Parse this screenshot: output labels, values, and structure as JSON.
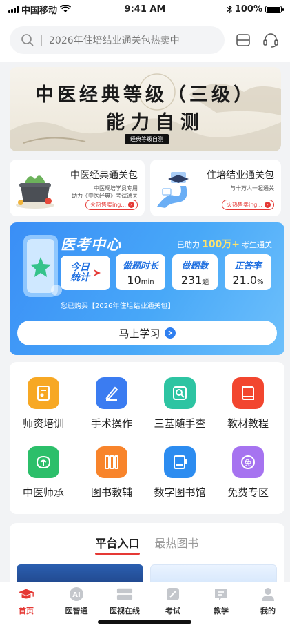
{
  "status_bar": {
    "carrier": "中国移动",
    "time": "9:41 AM",
    "battery": "100%",
    "battery_level": 1.0
  },
  "search": {
    "placeholder": "2026年住培结业通关包热卖中"
  },
  "banner": {
    "title": "中医经典等级（三级）",
    "subtitle": "能力自测",
    "seal_text": "经典等级自测"
  },
  "pass_cards": [
    {
      "title": "中医经典通关包",
      "desc_line1": "中医规培学员专用",
      "desc_line2": "助力《中医经典》考试通关",
      "badge": "火热售卖ing..."
    },
    {
      "title": "住培结业通关包",
      "desc_line1": "与十万人一起通关",
      "desc_line2": "",
      "badge": "火热售卖ing..."
    }
  ],
  "exam_center": {
    "title": "医考中心",
    "helped_prefix": "已助力",
    "helped_count": "100万+",
    "helped_suffix": "考生通关",
    "today_label": "今日统计",
    "stats": [
      {
        "label": "做题时长",
        "value": "10",
        "unit": "min"
      },
      {
        "label": "做题数",
        "value": "231",
        "unit": "题"
      },
      {
        "label": "正答率",
        "value": "21.0",
        "unit": "%"
      }
    ],
    "purchased": "您已购买【2026年住培结业通关包】",
    "study_button": "马上学习"
  },
  "grid": [
    {
      "label": "师资培训",
      "icon": "teacher-training-icon",
      "color": "#f7a824"
    },
    {
      "label": "手术操作",
      "icon": "surgery-icon",
      "color": "#3b7cf1"
    },
    {
      "label": "三基随手查",
      "icon": "lookup-icon",
      "color": "#2dc4a2"
    },
    {
      "label": "教材教程",
      "icon": "textbook-icon",
      "color": "#f2462f"
    },
    {
      "label": "中医师承",
      "icon": "tcm-heritage-icon",
      "color": "#2cbf6a"
    },
    {
      "label": "图书教辅",
      "icon": "books-icon",
      "color": "#f8842b"
    },
    {
      "label": "数字图书馆",
      "icon": "digital-library-icon",
      "color": "#2c8cf0"
    },
    {
      "label": "免费专区",
      "icon": "free-zone-icon",
      "color": "#a673f0"
    }
  ],
  "entry": {
    "tab_active": "平台入口",
    "tab_inactive": "最热图书"
  },
  "tabs": [
    {
      "label": "首页",
      "icon": "graduation-cap-icon"
    },
    {
      "label": "医智通",
      "icon": "ai-icon"
    },
    {
      "label": "医视在线",
      "icon": "video-icon"
    },
    {
      "label": "考试",
      "icon": "exam-icon"
    },
    {
      "label": "教学",
      "icon": "teaching-icon"
    },
    {
      "label": "我的",
      "icon": "profile-icon"
    }
  ]
}
